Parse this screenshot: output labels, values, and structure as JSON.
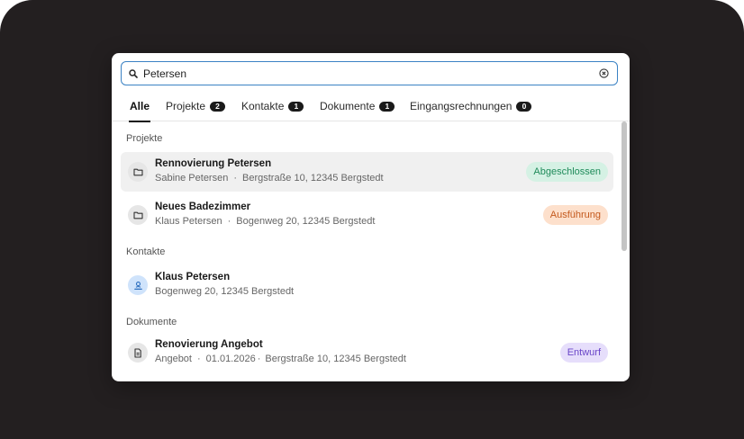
{
  "search": {
    "value": "Petersen",
    "placeholder": ""
  },
  "tabs": [
    {
      "label": "Alle",
      "count": ""
    },
    {
      "label": "Projekte",
      "count": "2"
    },
    {
      "label": "Kontakte",
      "count": "1"
    },
    {
      "label": "Dokumente",
      "count": "1"
    },
    {
      "label": "Eingangsrechnungen",
      "count": "0"
    }
  ],
  "sections": {
    "projekte": "Projekte",
    "kontakte": "Kontakte",
    "dokumente": "Dokumente"
  },
  "projects": [
    {
      "title": "Rennovierung Petersen",
      "person": "Sabine Petersen",
      "sep": "·",
      "address": "Bergstraße 10, 12345 Bergstedt",
      "status": "Abgeschlossen",
      "status_color": "#1f8b5a"
    },
    {
      "title": "Neues Badezimmer",
      "person": "Klaus Petersen",
      "sep": "·",
      "address": "Bogenweg 20, 12345 Bergstedt",
      "status": "Ausführung",
      "status_color": "#c4591d"
    }
  ],
  "contacts": [
    {
      "title": "Klaus Petersen",
      "address": "Bogenweg 20, 12345 Bergstedt"
    }
  ],
  "documents": [
    {
      "title": "Renovierung Angebot",
      "type": "Angebot",
      "sep": "·",
      "date": "01.01.2026",
      "sep2": "·",
      "address": "Bergstraße 10, 12345 Bergstedt",
      "status": "Entwurf",
      "status_color": "#6a46c8"
    }
  ],
  "icons": {
    "search": "search-icon",
    "clear": "clear-icon",
    "project": "folder-icon",
    "contact": "person-icon",
    "document": "document-icon"
  },
  "colors": {
    "accent": "#3b82c4",
    "backdrop": "#231f20"
  }
}
